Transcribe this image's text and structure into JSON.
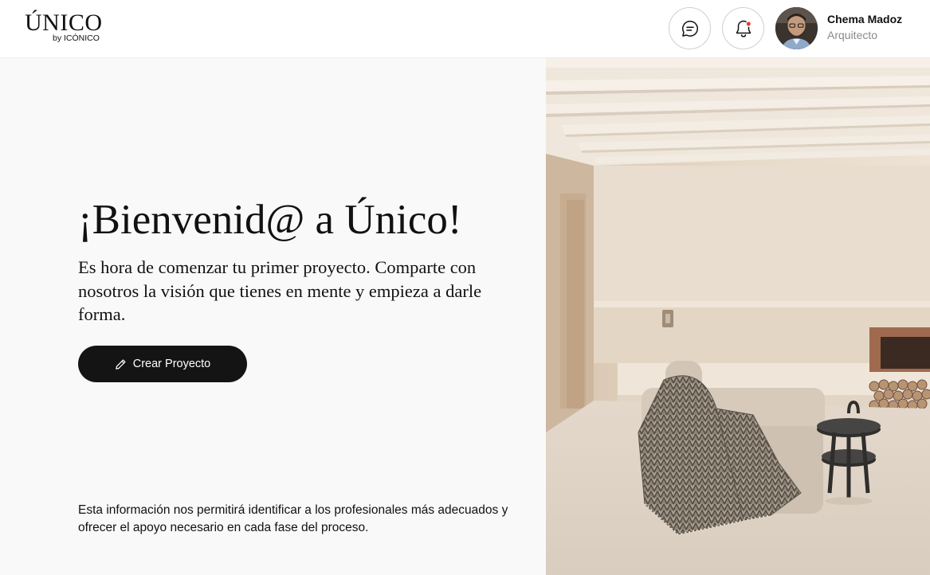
{
  "brand": {
    "logo_text": "ÚNICO",
    "logo_subtext": "by ICÓNICO"
  },
  "header": {
    "icons": {
      "messages": "chat-bubble-icon",
      "notifications": "bell-icon",
      "notification_dot_color": "#e53935"
    },
    "user": {
      "name": "Chema Madoz",
      "role": "Arquitecto"
    }
  },
  "main": {
    "title": "¡Bienvenid@ a Único!",
    "subtitle": "Es hora de comenzar tu primer proyecto. Comparte con nosotros la visión que tienes en mente y empieza a darle forma.",
    "create_button": {
      "label": "Crear Proyecto",
      "icon": "pencil-icon"
    },
    "info_text": "Esta información nos permitirá identificar a los profesionales más adecuados y ofrecer el apoyo necesario en cada fase del proceso."
  },
  "colors": {
    "primary_button": "#141414",
    "left_panel_bg": "#f9f9f9",
    "secondary_text": "#8a8a8a"
  }
}
